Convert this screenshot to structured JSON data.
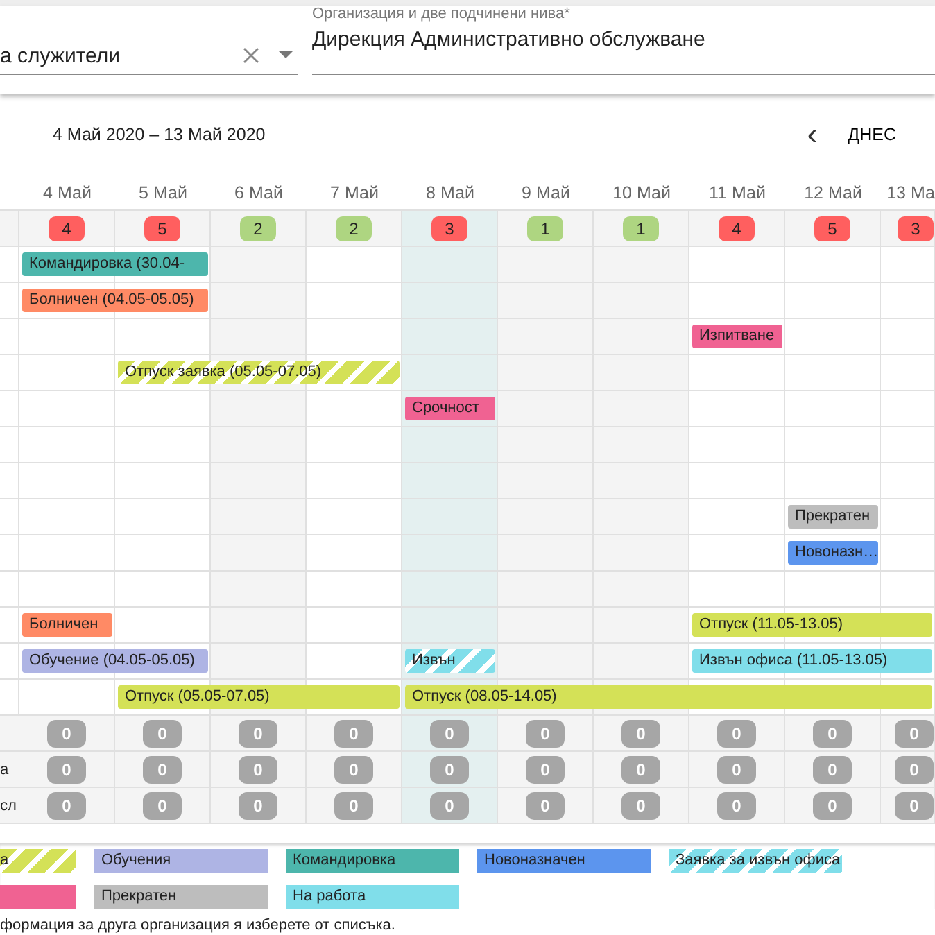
{
  "filters": {
    "employees": {
      "value": "а служители"
    },
    "organization": {
      "label": "Организация и две подчинени нива*",
      "value": "Дирекция Административно обслужване"
    }
  },
  "toolbar": {
    "range": "4 Май 2020 – 13 Май 2020",
    "prev": "‹",
    "today": "ДНЕС"
  },
  "days": [
    {
      "label": "4 Май",
      "count": "4",
      "color": "#ff5f5f",
      "kind": "workday"
    },
    {
      "label": "5 Май",
      "count": "5",
      "color": "#ff5f5f",
      "kind": "workday"
    },
    {
      "label": "6 Май",
      "count": "2",
      "color": "#aed581",
      "kind": "holiday"
    },
    {
      "label": "7 Май",
      "count": "2",
      "color": "#aed581",
      "kind": "workday"
    },
    {
      "label": "8 Май",
      "count": "3",
      "color": "#ff5f5f",
      "kind": "today"
    },
    {
      "label": "9 Май",
      "count": "1",
      "color": "#aed581",
      "kind": "holiday"
    },
    {
      "label": "10 Май",
      "count": "1",
      "color": "#aed581",
      "kind": "holiday"
    },
    {
      "label": "11 Май",
      "count": "4",
      "color": "#ff5f5f",
      "kind": "workday"
    },
    {
      "label": "12 Май",
      "count": "5",
      "color": "#ff5f5f",
      "kind": "workday"
    },
    {
      "label": "13 Ма",
      "count": "3",
      "color": "#ff5f5f",
      "kind": "workday"
    }
  ],
  "rows": [
    {
      "cells": [
        {
          "event": {
            "text": "Командировка (30.04-",
            "color": "#4db6ac",
            "kind": "solid"
          }
        },
        {
          "continued": true
        },
        {},
        {},
        {},
        {},
        {},
        {},
        {},
        {}
      ]
    },
    {
      "cells": [
        {
          "event": {
            "text": "Болничен (04.05-05.05)",
            "color": "#ff8a65",
            "kind": "solid"
          }
        },
        {
          "continued": true
        },
        {},
        {},
        {},
        {},
        {},
        {},
        {},
        {}
      ]
    },
    {
      "cells": [
        {},
        {},
        {},
        {},
        {},
        {},
        {},
        {
          "event": {
            "text": "Изпитване",
            "color": "#f06292",
            "kind": "solid"
          }
        },
        {},
        {}
      ]
    },
    {
      "cells": [
        {},
        {
          "event": {
            "text": "Отпуск заявка (05.05-07.05)",
            "color": "#d4e157",
            "kind": "striped"
          }
        },
        {
          "continued": true
        },
        {
          "continued": true
        },
        {},
        {},
        {},
        {},
        {},
        {}
      ]
    },
    {
      "cells": [
        {},
        {},
        {},
        {},
        {
          "event": {
            "text": "Срочност",
            "color": "#f06292",
            "kind": "solid"
          }
        },
        {},
        {},
        {},
        {},
        {}
      ]
    },
    {
      "cells": [
        {},
        {},
        {},
        {},
        {},
        {},
        {},
        {},
        {},
        {}
      ]
    },
    {
      "cells": [
        {},
        {},
        {},
        {},
        {},
        {},
        {},
        {},
        {},
        {}
      ]
    },
    {
      "cells": [
        {},
        {},
        {},
        {},
        {},
        {},
        {},
        {},
        {
          "event": {
            "text": "Прекратен",
            "color": "#bdbdbd",
            "kind": "solid"
          }
        },
        {}
      ]
    },
    {
      "cells": [
        {},
        {},
        {},
        {},
        {},
        {},
        {},
        {},
        {
          "event": {
            "text": "Новоназн…",
            "color": "#5c95ee",
            "kind": "solid"
          }
        },
        {}
      ]
    },
    {
      "cells": [
        {},
        {},
        {},
        {},
        {},
        {},
        {},
        {},
        {},
        {}
      ]
    },
    {
      "cells": [
        {
          "event": {
            "text": "Болничен",
            "color": "#ff8a65",
            "kind": "solid"
          }
        },
        {},
        {},
        {},
        {},
        {},
        {},
        {
          "event": {
            "text": "Отпуск (11.05-13.05)",
            "color": "#d4e157",
            "kind": "solid"
          }
        },
        {
          "continued": true
        },
        {
          "continued": true
        }
      ]
    },
    {
      "cells": [
        {
          "event": {
            "text": "Обучение (04.05-05.05)",
            "color": "#aeb4e4",
            "kind": "solid"
          }
        },
        {
          "continued": true
        },
        {},
        {},
        {
          "event": {
            "text": "Извън",
            "color": "#80deea",
            "kind": "striped"
          }
        },
        {},
        {},
        {
          "event": {
            "text": "Извън офиса (11.05-13.05)",
            "color": "#80deea",
            "kind": "solid"
          }
        },
        {
          "continued": true
        },
        {
          "continued": true
        }
      ]
    },
    {
      "cells": [
        {},
        {
          "event": {
            "text": "Отпуск (05.05-07.05)",
            "color": "#d4e157",
            "kind": "solid"
          }
        },
        {
          "continued": true
        },
        {
          "continued": true
        },
        {
          "event": {
            "text": "Отпуск (08.05-14.05)",
            "color": "#d4e157",
            "kind": "solid"
          }
        },
        {
          "continued": true
        },
        {
          "continued": true
        },
        {
          "continued": true
        },
        {
          "continued": true
        },
        {
          "continued": true
        }
      ]
    }
  ],
  "summary": [
    {
      "values": [
        "0",
        "0",
        "0",
        "0",
        "0",
        "0",
        "0",
        "0",
        "0",
        "0"
      ]
    },
    {
      "label": "а",
      "values": [
        "0",
        "0",
        "0",
        "0",
        "0",
        "0",
        "0",
        "0",
        "0",
        "0"
      ]
    },
    {
      "label": "сл",
      "values": [
        "0",
        "0",
        "0",
        "0",
        "0",
        "0",
        "0",
        "0",
        "0",
        "0"
      ]
    }
  ],
  "legend": [
    [
      {
        "text": "а",
        "color": "#d4e157",
        "kind": "striped",
        "partial": true
      },
      {
        "text": "Обучения",
        "color": "#aeb4e4",
        "kind": "solid",
        "partial": false
      },
      {
        "text": "Командировка",
        "color": "#4db6ac",
        "kind": "solid",
        "partial": false
      },
      {
        "text": "Новоназначен",
        "color": "#5c95ee",
        "kind": "solid",
        "partial": false
      },
      {
        "text": "Заявка за извън офиса",
        "color": "#80deea",
        "kind": "striped",
        "partial": false
      }
    ],
    [
      {
        "color": "#f06292",
        "kind": "solid",
        "partial": true
      },
      {
        "text": "Прекратен",
        "color": "#bdbdbd",
        "kind": "solid",
        "partial": false
      },
      {
        "text": "На работа",
        "color": "#80deea",
        "kind": "solid",
        "partial": false
      }
    ]
  ],
  "note": "формация за друга организация я изберете от списъка."
}
